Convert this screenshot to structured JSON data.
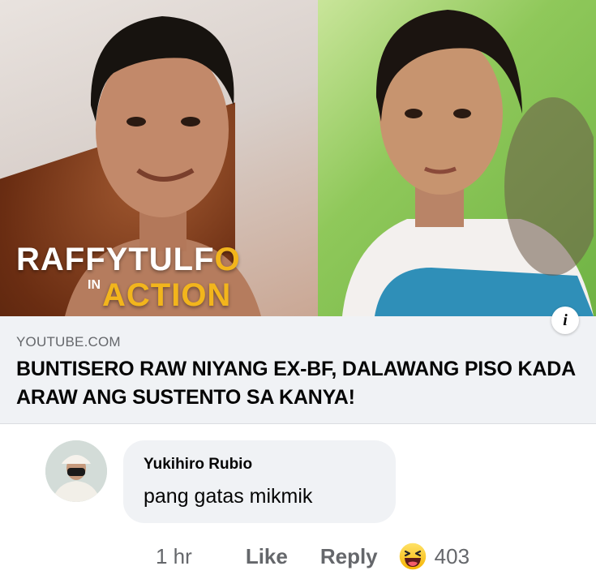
{
  "link_preview": {
    "show_logo": {
      "line1_main": "RAFFYTULF",
      "line1_o": "O",
      "line2_prefix": "IN",
      "line2_main": "ACTION"
    },
    "info_label": "i",
    "domain": "YOUTUBE.COM",
    "title": "BUNTISERO RAW NIYANG EX-BF, DALAWANG PISO KADA ARAW ANG SUSTENTO SA KANYA!"
  },
  "comment": {
    "author": "Yukihiro Rubio",
    "text": "pang gatas mikmik",
    "time": "1 hr",
    "like_label": "Like",
    "reply_label": "Reply",
    "reaction_icon": "haha-emoji-icon",
    "reaction_count": "403"
  },
  "colors": {
    "logo_accent": "#f2b51c",
    "meta_gray": "#65676b",
    "bubble_bg": "#f0f2f5"
  }
}
